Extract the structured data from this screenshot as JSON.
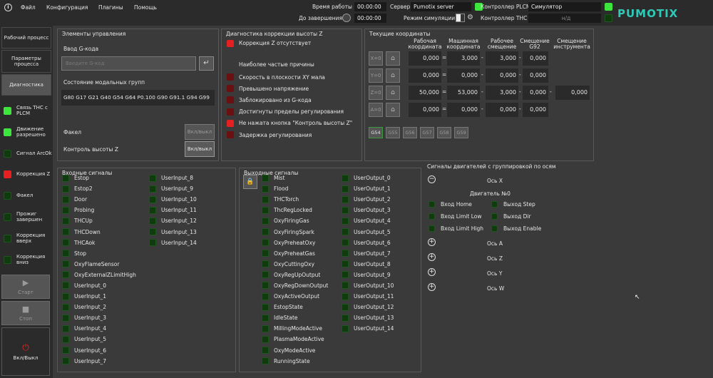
{
  "menu": {
    "items": [
      "Файл",
      "Конфигурация",
      "Плагины",
      "Помощь"
    ]
  },
  "top": {
    "work_time_label": "Время работы",
    "work_time": "00:00:00",
    "remaining_label": "До завершения",
    "remaining": "00:00:00",
    "server_label": "Сервер",
    "server": "Pumotix server",
    "plcm_label": "Контроллер PLCM",
    "plcm": "Симулятор",
    "sim_label": "Режим симуляции",
    "thc_label": "Контроллер THC",
    "thc": "н/д"
  },
  "logo": "PUMOTIX",
  "nav": {
    "tabs": [
      "Рабочий процесс",
      "Параметры процесса",
      "Диагностика"
    ]
  },
  "side_indicators": [
    {
      "label": "Связь THC с PLCM",
      "state": "on"
    },
    {
      "label": "Движение разрешено",
      "state": "on"
    },
    {
      "label": "Сигнал ArcOk",
      "state": "off"
    },
    {
      "label": "Коррекция Z",
      "state": "alarm"
    },
    {
      "label": "Факел",
      "state": "off"
    },
    {
      "label": "Прожиг завершен",
      "state": "off"
    },
    {
      "label": "Коррекция вверх",
      "state": "off"
    },
    {
      "label": "Коррекция вниз",
      "state": "off"
    }
  ],
  "actions": {
    "start": "Старт",
    "stop": "Стоп",
    "power": "Вкл/Выкл"
  },
  "controls": {
    "title": "Элементы управления",
    "gcode_label": "Ввод G-кода",
    "gcode_placeholder": "Введите G-код",
    "modal_label": "Состояние модальных групп",
    "modal_value": "G80 G17 G21 G40 G54 G64 P0.100 G90 G91.1 G94 G99",
    "torch_label": "Факел",
    "torch_btn": "Вкл/выкл",
    "height_label": "Контроль высоты Z",
    "height_btn": "Вкл/выкл"
  },
  "diag": {
    "title": "Диагностика коррекции высоты Z",
    "status": "Коррекция Z отсутствует",
    "causes_title": "Наиболее частые причины",
    "causes": [
      {
        "label": "Скорость в плоскости XY мала",
        "state": "dim"
      },
      {
        "label": "Превышено напряжение",
        "state": "dim"
      },
      {
        "label": "Заблокировано из G-кода",
        "state": "dim"
      },
      {
        "label": "Достигнуты пределы регулирования",
        "state": "dim"
      },
      {
        "label": "Не нажата кнопка \"Контроль высоты Z\"",
        "state": "on"
      },
      {
        "label": "Задержка регулирования",
        "state": "dim"
      }
    ]
  },
  "coords": {
    "title": "Текущие координаты",
    "headers": [
      "Рабочая координата",
      "Машинная координата",
      "Рабочее смещение",
      "Смещение G92",
      "Смещение инструмента"
    ],
    "rows": [
      {
        "axis": "X=0",
        "work": "0,000",
        "machine": "3,000",
        "offset": "3,000",
        "g92": "0,000",
        "tool": ""
      },
      {
        "axis": "Y=0",
        "work": "0,000",
        "machine": "0,000",
        "offset": "0,000",
        "g92": "0,000",
        "tool": ""
      },
      {
        "axis": "Z=0",
        "work": "50,000",
        "machine": "53,000",
        "offset": "3,000",
        "g92": "0,000",
        "tool": "0,000"
      },
      {
        "axis": "A=0",
        "work": "0,000",
        "machine": "0,000",
        "offset": "0,000",
        "g92": "0,000",
        "tool": ""
      }
    ],
    "g_tabs": [
      "G54",
      "G55",
      "G56",
      "G57",
      "G58",
      "G59"
    ],
    "active_tab": "G54"
  },
  "inputs": {
    "title": "Входные сигналы",
    "col1": [
      "Estop",
      "Estop2",
      "Door",
      "Probing",
      "THCUp",
      "THCDown",
      "THCAok",
      "Stop",
      "OxyFlameSensor",
      "OxyExternalZLimitHigh",
      "UserInput_0",
      "UserInput_1",
      "UserInput_2",
      "UserInput_3",
      "UserInput_4",
      "UserInput_5",
      "UserInput_6",
      "UserInput_7"
    ],
    "col2": [
      "UserInput_8",
      "UserInput_9",
      "UserInput_10",
      "UserInput_11",
      "UserInput_12",
      "UserInput_13",
      "UserInput_14"
    ]
  },
  "outputs": {
    "title": "Выходные сигналы",
    "col1": [
      "Mist",
      "Flood",
      "THCTorch",
      "ThcRegLocked",
      "OxyFiringGas",
      "OxyFiringSpark",
      "OxyPreheatOxy",
      "OxyPreheatGas",
      "OxyCuttingOxy",
      "OxyRegUpOutput",
      "OxyRegDownOutput",
      "OxyActiveOutput",
      "EstopState",
      "IdleState",
      "MillingModeActive",
      "PlasmaModeActive",
      "OxyModeActive",
      "RunningState"
    ],
    "col2": [
      "UserOutput_0",
      "UserOutput_1",
      "UserOutput_2",
      "UserOutput_3",
      "UserOutput_4",
      "UserOutput_5",
      "UserOutput_6",
      "UserOutput_7",
      "UserOutput_8",
      "UserOutput_9",
      "UserOutput_10",
      "UserOutput_11",
      "UserOutput_12",
      "UserOutput_13",
      "UserOutput_14"
    ]
  },
  "motors": {
    "title": "Сигналы двигателей с группировкой по осям",
    "axis_x": "Ось X",
    "motor0": "Двигатель №0",
    "signals": [
      "Вход Home",
      "Выход Step",
      "Вход Limit Low",
      "Выход Dir",
      "Вход Limit High",
      "Выход Enable"
    ],
    "axes": [
      "Ось A",
      "Ось Z",
      "Ось Y",
      "Ось W"
    ]
  }
}
